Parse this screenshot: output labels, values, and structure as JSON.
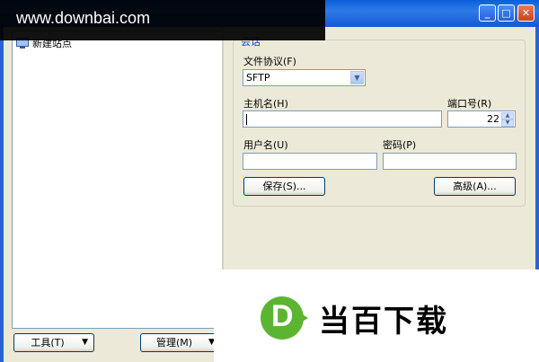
{
  "watermark": {
    "text": "www.downbai.com"
  },
  "titlebar": {
    "minimize": "_",
    "maximize": "□",
    "close": "✕"
  },
  "sidebar": {
    "items": [
      {
        "label": "新建站点",
        "icon": "monitor-icon"
      }
    ]
  },
  "group": {
    "legend": "会话",
    "protocol": {
      "label": "文件协议(F)",
      "value": "SFTP"
    },
    "host": {
      "label": "主机名(H)",
      "value": ""
    },
    "port": {
      "label": "端口号(R)",
      "value": "22"
    },
    "user": {
      "label": "用户名(U)",
      "value": ""
    },
    "password": {
      "label": "密码(P)",
      "value": ""
    },
    "save_button": "保存(S)...",
    "advanced_button": "高级(A)..."
  },
  "bottom": {
    "tools_button": "工具(T)",
    "manage_button": "管理(M)"
  },
  "logo": {
    "letter": "D",
    "text": "当百下载",
    "brand_color": "#5cb531"
  }
}
